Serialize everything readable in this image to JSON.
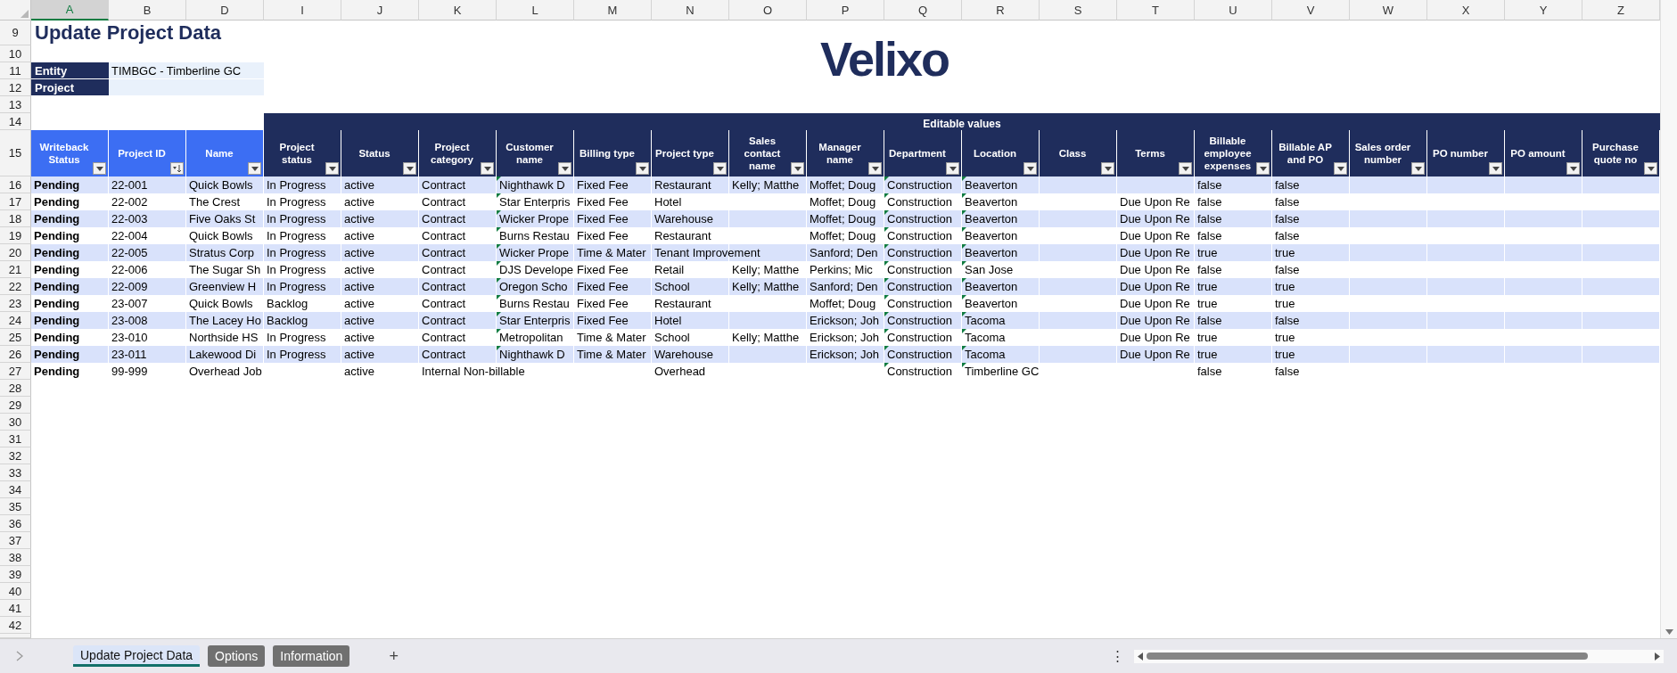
{
  "column_letters": [
    {
      "label": "A",
      "selected": true
    },
    {
      "label": "B",
      "selected": false
    },
    {
      "label": "D",
      "selected": false
    },
    {
      "label": "I",
      "selected": false
    },
    {
      "label": "J",
      "selected": false
    },
    {
      "label": "K",
      "selected": false
    },
    {
      "label": "L",
      "selected": false
    },
    {
      "label": "M",
      "selected": false
    },
    {
      "label": "N",
      "selected": false
    },
    {
      "label": "O",
      "selected": false
    },
    {
      "label": "P",
      "selected": false
    },
    {
      "label": "Q",
      "selected": false
    },
    {
      "label": "R",
      "selected": false
    },
    {
      "label": "S",
      "selected": false
    },
    {
      "label": "T",
      "selected": false
    },
    {
      "label": "U",
      "selected": false
    },
    {
      "label": "V",
      "selected": false
    },
    {
      "label": "W",
      "selected": false
    },
    {
      "label": "X",
      "selected": false
    },
    {
      "label": "Y",
      "selected": false
    },
    {
      "label": "Z",
      "selected": false
    }
  ],
  "row_numbers": [
    "9",
    "10",
    "11",
    "12",
    "13",
    "14",
    "15",
    "16",
    "17",
    "18",
    "19",
    "20",
    "21",
    "22",
    "23",
    "24",
    "25",
    "26",
    "27",
    "28",
    "29",
    "30",
    "31",
    "32",
    "33",
    "34",
    "35",
    "36",
    "37",
    "38",
    "39",
    "40",
    "41",
    "42"
  ],
  "title": "Update Project Data",
  "logo": "Velixo",
  "parameters": [
    {
      "label": "Entity",
      "value": "TIMBGC - Timberline GC"
    },
    {
      "label": "Project"
    }
  ],
  "section_header": "Editable values",
  "table": {
    "columns": [
      {
        "label": "Writeback Status",
        "kind": "key",
        "sorted": false
      },
      {
        "label": "Project ID",
        "kind": "key",
        "sorted": true
      },
      {
        "label": "Name",
        "kind": "key",
        "sorted": false
      },
      {
        "label": "Project status",
        "kind": "editable",
        "sorted": false
      },
      {
        "label": "Status",
        "kind": "editable",
        "sorted": false
      },
      {
        "label": "Project category",
        "kind": "editable",
        "sorted": false
      },
      {
        "label": "Customer name",
        "kind": "editable",
        "sorted": false
      },
      {
        "label": "Billing type",
        "kind": "editable",
        "sorted": false
      },
      {
        "label": "Project type",
        "kind": "editable",
        "sorted": false
      },
      {
        "label": "Sales contact name",
        "kind": "editable",
        "sorted": false
      },
      {
        "label": "Manager name",
        "kind": "editable",
        "sorted": false
      },
      {
        "label": "Department",
        "kind": "editable",
        "sorted": false
      },
      {
        "label": "Location",
        "kind": "editable",
        "sorted": false
      },
      {
        "label": "Class",
        "kind": "editable",
        "sorted": false
      },
      {
        "label": "Terms",
        "kind": "editable",
        "sorted": false
      },
      {
        "label": "Billable employee expenses",
        "kind": "editable",
        "sorted": false
      },
      {
        "label": "Billable AP and PO",
        "kind": "editable",
        "sorted": false
      },
      {
        "label": "Sales order number",
        "kind": "editable",
        "sorted": false
      },
      {
        "label": "PO number",
        "kind": "editable",
        "sorted": false
      },
      {
        "label": "PO amount",
        "kind": "editable",
        "sorted": false
      },
      {
        "label": "Purchase quote no",
        "kind": "editable",
        "sorted": false
      }
    ],
    "rows": [
      {
        "cells": [
          "Pending",
          "22-001",
          "Quick Bowls",
          "In Progress",
          "active",
          "Contract",
          {
            "text": "Nighthawk D",
            "flagged": true
          },
          "Fixed Fee",
          "Restaurant",
          "Kelly; Matthe",
          "Moffet; Doug",
          {
            "text": "Construction",
            "flagged": true
          },
          {
            "text": "Beaverton",
            "flagged": true
          },
          null,
          null,
          "false",
          "false",
          null,
          null,
          null,
          null
        ]
      },
      {
        "cells": [
          "Pending",
          "22-002",
          "The Crest",
          "In Progress",
          "active",
          "Contract",
          {
            "text": "Star Enterpris",
            "flagged": true
          },
          "Fixed Fee",
          "Hotel",
          null,
          "Moffet; Doug",
          {
            "text": "Construction",
            "flagged": true
          },
          {
            "text": "Beaverton",
            "flagged": true
          },
          null,
          "Due Upon Re",
          "false",
          "false",
          null,
          null,
          null,
          null
        ]
      },
      {
        "cells": [
          "Pending",
          "22-003",
          "Five Oaks St",
          "In Progress",
          "active",
          "Contract",
          {
            "text": "Wicker Prope",
            "flagged": true
          },
          "Fixed Fee",
          "Warehouse",
          null,
          "Moffet; Doug",
          {
            "text": "Construction",
            "flagged": true
          },
          {
            "text": "Beaverton",
            "flagged": true
          },
          null,
          "Due Upon Re",
          "false",
          "false",
          null,
          null,
          null,
          null
        ]
      },
      {
        "cells": [
          "Pending",
          "22-004",
          "Quick Bowls",
          "In Progress",
          "active",
          "Contract",
          {
            "text": "Burns Restau",
            "flagged": true
          },
          "Fixed Fee",
          "Restaurant",
          null,
          "Moffet; Doug",
          {
            "text": "Construction",
            "flagged": true
          },
          {
            "text": "Beaverton",
            "flagged": true
          },
          null,
          "Due Upon Re",
          "false",
          "false",
          null,
          null,
          null,
          null
        ]
      },
      {
        "cells": [
          "Pending",
          "22-005",
          "Stratus Corp",
          "In Progress",
          "active",
          "Contract",
          {
            "text": "Wicker Prope",
            "flagged": true
          },
          "Time & Mater",
          "Tenant Improvement",
          null,
          "Sanford; Den",
          {
            "text": "Construction",
            "flagged": true
          },
          {
            "text": "Beaverton",
            "flagged": true
          },
          null,
          "Due Upon Re",
          "true",
          "true",
          null,
          null,
          null,
          null
        ]
      },
      {
        "cells": [
          "Pending",
          "22-006",
          "The Sugar Sh",
          "In Progress",
          "active",
          "Contract",
          {
            "text": "DJS Develope",
            "flagged": true
          },
          "Fixed Fee",
          "Retail",
          "Kelly; Matthe",
          "Perkins; Mic",
          {
            "text": "Construction",
            "flagged": true
          },
          {
            "text": "San Jose",
            "flagged": true
          },
          null,
          "Due Upon Re",
          "false",
          "false",
          null,
          null,
          null,
          null
        ]
      },
      {
        "cells": [
          "Pending",
          "22-009",
          "Greenview H",
          "In Progress",
          "active",
          "Contract",
          {
            "text": "Oregon Scho",
            "flagged": true
          },
          "Fixed Fee",
          "School",
          "Kelly; Matthe",
          "Sanford; Den",
          {
            "text": "Construction",
            "flagged": true
          },
          {
            "text": "Beaverton",
            "flagged": true
          },
          null,
          "Due Upon Re",
          "true",
          "true",
          null,
          null,
          null,
          null
        ]
      },
      {
        "cells": [
          "Pending",
          "23-007",
          "Quick Bowls",
          "Backlog",
          "active",
          "Contract",
          {
            "text": "Burns Restau",
            "flagged": true
          },
          "Fixed Fee",
          "Restaurant",
          null,
          "Moffet; Doug",
          {
            "text": "Construction",
            "flagged": true
          },
          {
            "text": "Beaverton",
            "flagged": true
          },
          null,
          "Due Upon Re",
          "true",
          "true",
          null,
          null,
          null,
          null
        ]
      },
      {
        "cells": [
          "Pending",
          "23-008",
          "The Lacey Ho",
          "Backlog",
          "active",
          "Contract",
          {
            "text": "Star Enterpris",
            "flagged": true
          },
          "Fixed Fee",
          "Hotel",
          null,
          "Erickson; Joh",
          {
            "text": "Construction",
            "flagged": true
          },
          {
            "text": "Tacoma",
            "flagged": true
          },
          null,
          "Due Upon Re",
          "false",
          "false",
          null,
          null,
          null,
          null
        ]
      },
      {
        "cells": [
          "Pending",
          "23-010",
          "Northside HS",
          "In Progress",
          "active",
          "Contract",
          {
            "text": "Metropolitan",
            "flagged": true
          },
          "Time & Mater",
          "School",
          "Kelly; Matthe",
          "Erickson; Joh",
          {
            "text": "Construction",
            "flagged": true
          },
          {
            "text": "Tacoma",
            "flagged": true
          },
          null,
          "Due Upon Re",
          "true",
          "true",
          null,
          null,
          null,
          null
        ]
      },
      {
        "cells": [
          "Pending",
          "23-011",
          "Lakewood Di",
          "In Progress",
          "active",
          "Contract",
          {
            "text": "Nighthawk D",
            "flagged": true
          },
          "Time & Mater",
          "Warehouse",
          null,
          "Erickson; Joh",
          {
            "text": "Construction",
            "flagged": true
          },
          {
            "text": "Tacoma",
            "flagged": true
          },
          null,
          "Due Upon Re",
          "true",
          "true",
          null,
          null,
          null,
          null
        ]
      },
      {
        "cells": [
          "Pending",
          "99-999",
          "Overhead Job",
          null,
          "active",
          "Internal Non-billable",
          null,
          null,
          "Overhead",
          null,
          null,
          {
            "text": "Construction",
            "flagged": true
          },
          {
            "text": "Timberline GC",
            "flagged": true
          },
          null,
          null,
          "false",
          "false",
          null,
          null,
          null,
          null
        ]
      }
    ]
  },
  "sheet_tabs": [
    {
      "label": "Update Project Data",
      "selected": true
    },
    {
      "label": "Options",
      "selected": false
    },
    {
      "label": "Information",
      "selected": false
    }
  ],
  "new_sheet_button": "+",
  "more_button": "⋮"
}
